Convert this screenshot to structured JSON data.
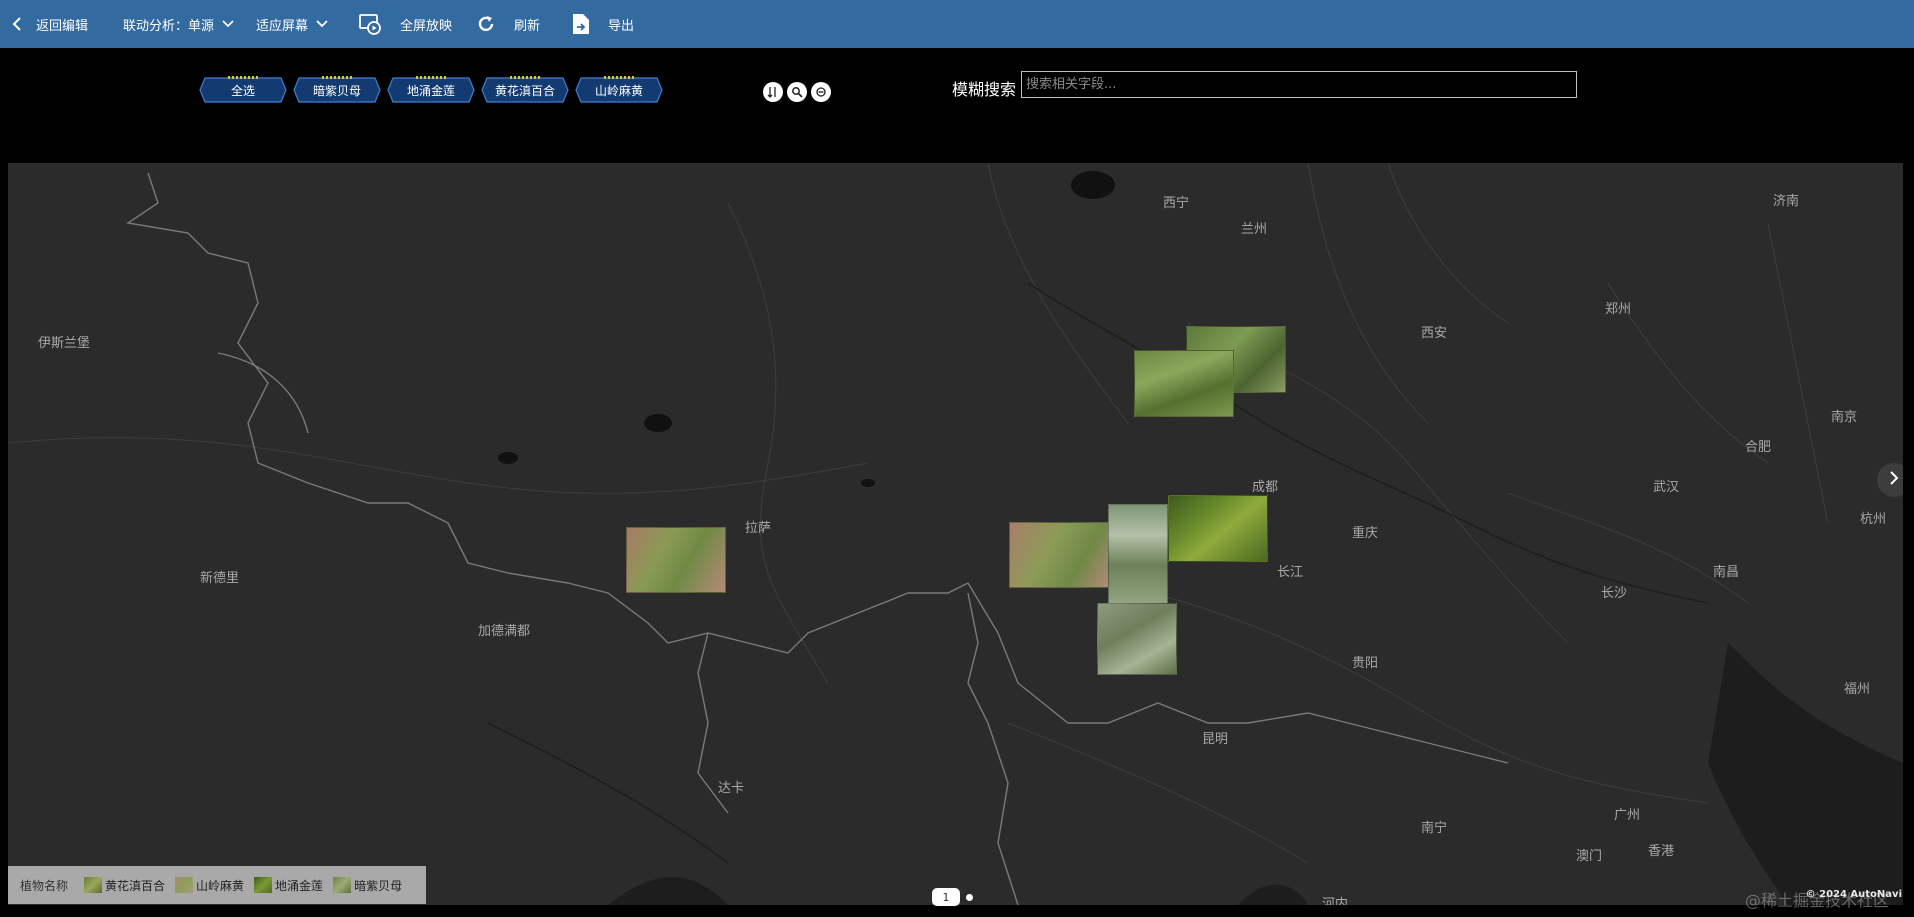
{
  "toolbar": {
    "back_label": "返回编辑",
    "linkage_label": "联动分析：单源",
    "fit_label": "适应屏幕",
    "fullscreen_label": "全屏放映",
    "refresh_label": "刷新",
    "export_label": "导出"
  },
  "filters": [
    {
      "label": "全选"
    },
    {
      "label": "暗紫贝母"
    },
    {
      "label": "地涌金莲"
    },
    {
      "label": "黄花滇百合"
    },
    {
      "label": "山岭麻黄"
    }
  ],
  "search": {
    "label": "模糊搜索",
    "placeholder": "搜索相关字段..."
  },
  "map": {
    "cities": [
      "西宁",
      "兰州",
      "济南",
      "郑州",
      "西安",
      "伊斯兰堡",
      "南京",
      "合肥",
      "成都",
      "武汉",
      "杭州",
      "拉萨",
      "重庆",
      "长江",
      "新德里",
      "南昌",
      "长沙",
      "加德满都",
      "贵阳",
      "福州",
      "昆明",
      "达卡",
      "南宁",
      "广州",
      "澳门",
      "香港",
      "河内"
    ]
  },
  "legend": {
    "title": "植物名称",
    "items": [
      {
        "label": "黄花滇百合",
        "color": "#7f8a4a"
      },
      {
        "label": "山岭麻黄",
        "color": "#9aa55a"
      },
      {
        "label": "地涌金莲",
        "color": "#5c6f2e"
      },
      {
        "label": "暗紫贝母",
        "color": "#8d9566"
      }
    ]
  },
  "pager": {
    "current": "1"
  },
  "copyright": "© 2024 AutoNavi",
  "watermark": "@稀土掘金技术社区"
}
